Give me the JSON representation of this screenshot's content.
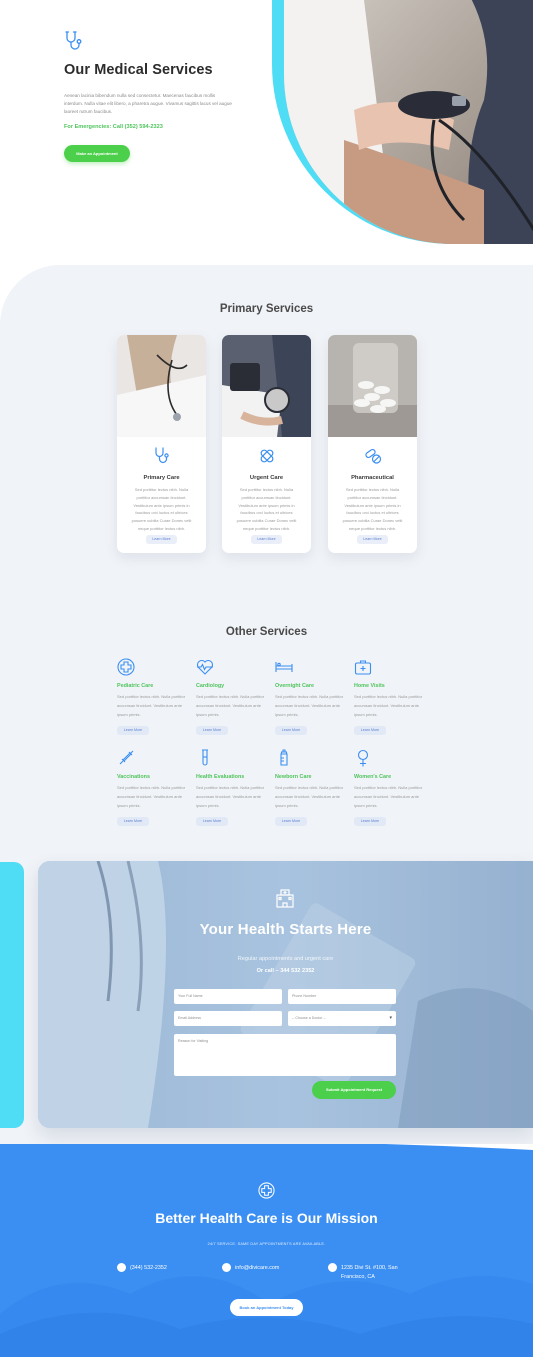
{
  "hero": {
    "title": "Our Medical Services",
    "description": "Aenean lacinia bibendum nulla sed consectetur. Maecenas faucibus mollis interdum. Nulla vitae elit libero, a pharetra augue. Vivamus sagittis lacus vel augue laoreet rutrum faucibus.",
    "emergency": "For Emergencies: Call (352) 594-2323",
    "button_label": "Make an Appointment",
    "icon": "stethoscope-icon"
  },
  "primary": {
    "title": "Primary Services",
    "cards": [
      {
        "name": "Primary Care",
        "icon": "stethoscope-icon",
        "text": "Sed porttitor lectus nibh. Nulla porttitor accumsan tincidunt. Vestibulum ante ipsum primis in faucibus orci luctus et ultrices posuere cubilia Curae Donec velit neque porttitor lectus nibh.",
        "button": "Learn More"
      },
      {
        "name": "Urgent Care",
        "icon": "bandage-icon",
        "text": "Sed porttitor lectus nibh. Nulla porttitor accumsan tincidunt. Vestibulum ante ipsum primis in faucibus orci luctus et ultrices posuere cubilia Curae Donec velit neque porttitor lectus nibh.",
        "button": "Learn More"
      },
      {
        "name": "Pharmaceutical",
        "icon": "pills-icon",
        "text": "Sed porttitor lectus nibh. Nulla porttitor accumsan tincidunt. Vestibulum ante ipsum primis in faucibus orci luctus et ultrices posuere cubilia Curae Donec velit neque porttitor lectus nibh.",
        "button": "Learn More"
      }
    ]
  },
  "other": {
    "title": "Other Services",
    "items": [
      {
        "name": "Pediatric Care",
        "icon": "medical-cross-icon",
        "text": "Sed porttitor lectus nibh. Nulla porttitor accumsan tincidunt. Vestibulum ante ipsum primis.",
        "button": "Learn More"
      },
      {
        "name": "Cardiology",
        "icon": "heart-pulse-icon",
        "text": "Sed porttitor lectus nibh. Nulla porttitor accumsan tincidunt. Vestibulum ante ipsum primis.",
        "button": "Learn More"
      },
      {
        "name": "Overnight Care",
        "icon": "hospital-bed-icon",
        "text": "Sed porttitor lectus nibh. Nulla porttitor accumsan tincidunt. Vestibulum ante ipsum primis.",
        "button": "Learn More"
      },
      {
        "name": "Home Visits",
        "icon": "medical-kit-icon",
        "text": "Sed porttitor lectus nibh. Nulla porttitor accumsan tincidunt. Vestibulum ante ipsum primis.",
        "button": "Learn More"
      },
      {
        "name": "Vaccinations",
        "icon": "syringe-icon",
        "text": "Sed porttitor lectus nibh. Nulla porttitor accumsan tincidunt. Vestibulum ante ipsum primis.",
        "button": "Learn More"
      },
      {
        "name": "Health Evaluations",
        "icon": "test-tube-icon",
        "text": "Sed porttitor lectus nibh. Nulla porttitor accumsan tincidunt. Vestibulum ante ipsum primis.",
        "button": "Learn More"
      },
      {
        "name": "Newborn Care",
        "icon": "baby-bottle-icon",
        "text": "Sed porttitor lectus nibh. Nulla porttitor accumsan tincidunt. Vestibulum ante ipsum primis.",
        "button": "Learn More"
      },
      {
        "name": "Women's Care",
        "icon": "female-symbol-icon",
        "text": "Sed porttitor lectus nibh. Nulla porttitor accumsan tincidunt. Vestibulum ante ipsum primis.",
        "button": "Learn More"
      }
    ]
  },
  "cta": {
    "icon": "hospital-icon",
    "title": "Your Health Starts Here",
    "subtitle": "Regular appointments and urgent care",
    "call": "Or call – 344 532 2352",
    "form": {
      "name_placeholder": "Your Full Name",
      "phone_placeholder": "Phone Number",
      "email_placeholder": "Email Address",
      "doctor_placeholder": "-- Choose a Doctor --",
      "reason_placeholder": "Reason for Visiting",
      "submit_label": "Submit Appointment Request"
    }
  },
  "footer": {
    "icon": "medical-cross-icon",
    "title": "Better Health Care is Our Mission",
    "small": "24/7 SERVICE. SAME DAY APPOINTMENTS ARE AVAILABLE.",
    "phone": "(344) 532-2352",
    "email": "info@divicare.com",
    "address": "1235 Divi St. #100, San Francisco, CA",
    "button_label": "Book an Appointment Today"
  },
  "colors": {
    "accent_green": "#4cd04c",
    "accent_cyan": "#4fdcf5",
    "icon_blue": "#3b8ff2",
    "footer_blue": "#3b8ff2",
    "section_gray": "#f0f3f7"
  }
}
